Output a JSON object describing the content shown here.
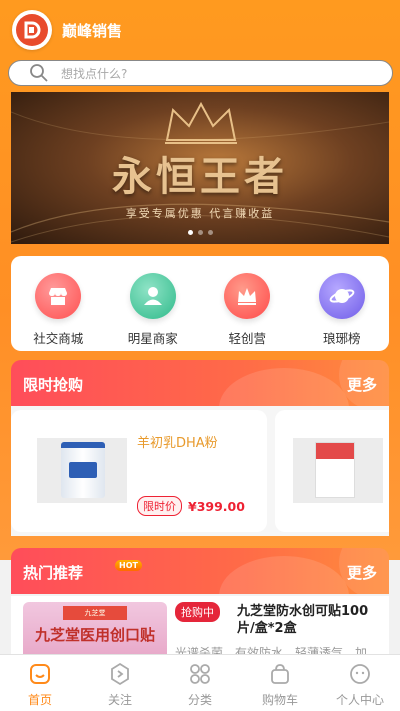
{
  "app": {
    "title": "巅峰销售"
  },
  "search": {
    "placeholder": "想找点什么?"
  },
  "banner": {
    "title": "永恒王者",
    "subtitle": "享受专属优惠 代言赚收益"
  },
  "categories": [
    {
      "label": "社交商城",
      "icon": "store-icon",
      "color": "#ff6060"
    },
    {
      "label": "明星商家",
      "icon": "merchant-icon",
      "color": "#3dc79a"
    },
    {
      "label": "轻创营",
      "icon": "crown-icon",
      "color": "#ff5252"
    },
    {
      "label": "琅琊榜",
      "icon": "planet-icon",
      "color": "#7e6cf0"
    }
  ],
  "flash_sale": {
    "title": "限时抢购",
    "more": "更多",
    "items": [
      {
        "name": "羊初乳DHA粉",
        "price_label": "限时价",
        "price": "¥399.00"
      }
    ]
  },
  "hot": {
    "title": "热门推荐",
    "badge": "HOT",
    "more": "更多",
    "item": {
      "tag": "抢购中",
      "name": "九芝堂防水创可贴100片/盒*2盒",
      "description": "光谱杀菌，有效防水，轻薄透气，加",
      "image_title": "九芝堂医用创口贴",
      "image_brand": "九芝堂"
    }
  },
  "tabbar": [
    {
      "label": "首页",
      "icon": "home-icon",
      "active": true
    },
    {
      "label": "关注",
      "icon": "follow-icon",
      "active": false
    },
    {
      "label": "分类",
      "icon": "category-icon",
      "active": false
    },
    {
      "label": "购物车",
      "icon": "cart-icon",
      "active": false
    },
    {
      "label": "个人中心",
      "icon": "profile-icon",
      "active": false
    }
  ],
  "colors": {
    "accent": "#ff8a1a",
    "price": "#ee2233",
    "section_red": "#ff4d5a"
  }
}
